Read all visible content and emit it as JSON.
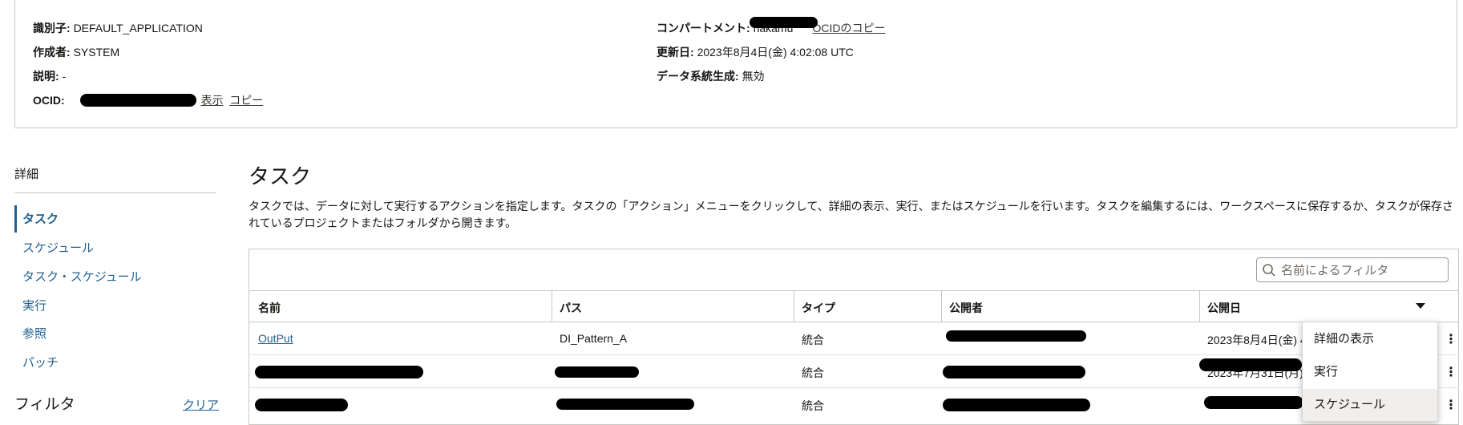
{
  "info": {
    "identifier_label": "識別子:",
    "identifier_value": "DEFAULT_APPLICATION",
    "author_label": "作成者:",
    "author_value": "SYSTEM",
    "description_label": "説明:",
    "description_value": "-",
    "ocid_label": "OCID:",
    "ocid_show": "表示",
    "ocid_copy": "コピー",
    "compartment_label": "コンパートメント:",
    "compartment_value_visible": "nakamu",
    "compartment_copy": "OCIDのコピー",
    "updated_label": "更新日:",
    "updated_value": "2023年8月4日(金) 4:02:08 UTC",
    "lineage_label": "データ系統生成:",
    "lineage_value": "無効"
  },
  "nav": {
    "heading": "詳細",
    "items": [
      {
        "label": "タスク",
        "active": true
      },
      {
        "label": "スケジュール"
      },
      {
        "label": "タスク・スケジュール"
      },
      {
        "label": "実行"
      },
      {
        "label": "参照"
      },
      {
        "label": "パッチ"
      }
    ],
    "filter_heading": "フィルタ",
    "clear_label": "クリア"
  },
  "main": {
    "title": "タスク",
    "description": "タスクでは、データに対して実行するアクションを指定します。タスクの「アクション」メニューをクリックして、詳細の表示、実行、またはスケジュールを行います。タスクを編集するには、ワークスペースに保存するか、タスクが保存されているプロジェクトまたはフォルダから開きます。",
    "filter_placeholder": "名前によるフィルタ"
  },
  "table": {
    "columns": [
      "名前",
      "パス",
      "タイプ",
      "公開者",
      "公開日"
    ],
    "rows": [
      {
        "name": "OutPut",
        "path": "DI_Pattern_A",
        "type": "統合",
        "publisher": "",
        "date": "2023年8月4日(金) 4"
      },
      {
        "name": "",
        "path": "",
        "type": "統合",
        "publisher": "",
        "date": "2023年7月31日(月)"
      },
      {
        "name": "",
        "path": "",
        "type": "統合",
        "publisher": "",
        "date": ""
      }
    ]
  },
  "menu": {
    "items": [
      "詳細の表示",
      "実行",
      "スケジュール"
    ]
  },
  "icons": {
    "search": "search-icon",
    "sort": "sort-desc-icon",
    "kebab": "kebab-menu-icon"
  }
}
